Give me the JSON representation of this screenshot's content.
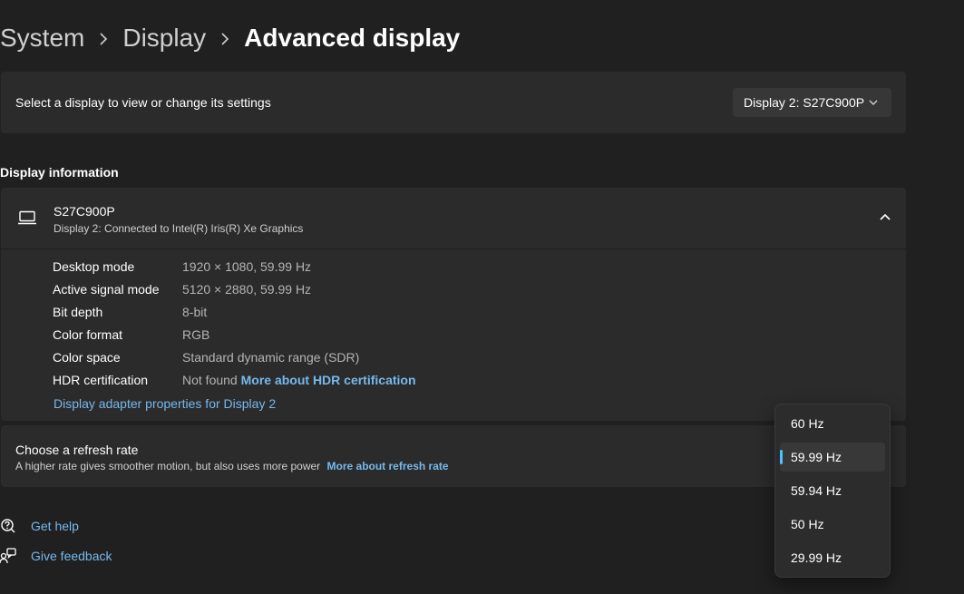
{
  "breadcrumb": {
    "items": [
      "System",
      "Display"
    ],
    "current": "Advanced display"
  },
  "display_select": {
    "label": "Select a display to view or change its settings",
    "selected": "Display 2: S27C900P"
  },
  "display_information": {
    "section_title": "Display information",
    "name": "S27C900P",
    "connection": "Display 2: Connected to Intel(R) Iris(R) Xe Graphics",
    "rows": [
      {
        "key": "Desktop mode",
        "value": "1920 × 1080, 59.99 Hz"
      },
      {
        "key": "Active signal mode",
        "value": "5120 × 2880, 59.99 Hz"
      },
      {
        "key": "Bit depth",
        "value": "8-bit"
      },
      {
        "key": "Color format",
        "value": "RGB"
      },
      {
        "key": "Color space",
        "value": "Standard dynamic range (SDR)"
      },
      {
        "key": "HDR certification",
        "value": "Not found",
        "link": "More about HDR certification"
      }
    ],
    "adapter_link": "Display adapter properties for Display 2"
  },
  "refresh_rate": {
    "title": "Choose a refresh rate",
    "description": "A higher rate gives smoother motion, but also uses more power",
    "link": "More about refresh rate",
    "options": [
      "60 Hz",
      "59.99 Hz",
      "59.94 Hz",
      "50 Hz",
      "29.99 Hz"
    ],
    "selected": "59.99 Hz"
  },
  "footer": {
    "help": "Get help",
    "feedback": "Give feedback"
  },
  "colors": {
    "background": "#202020",
    "card": "#2b2b2b",
    "accent": "#4cc2ff",
    "link": "#76b9ed"
  }
}
